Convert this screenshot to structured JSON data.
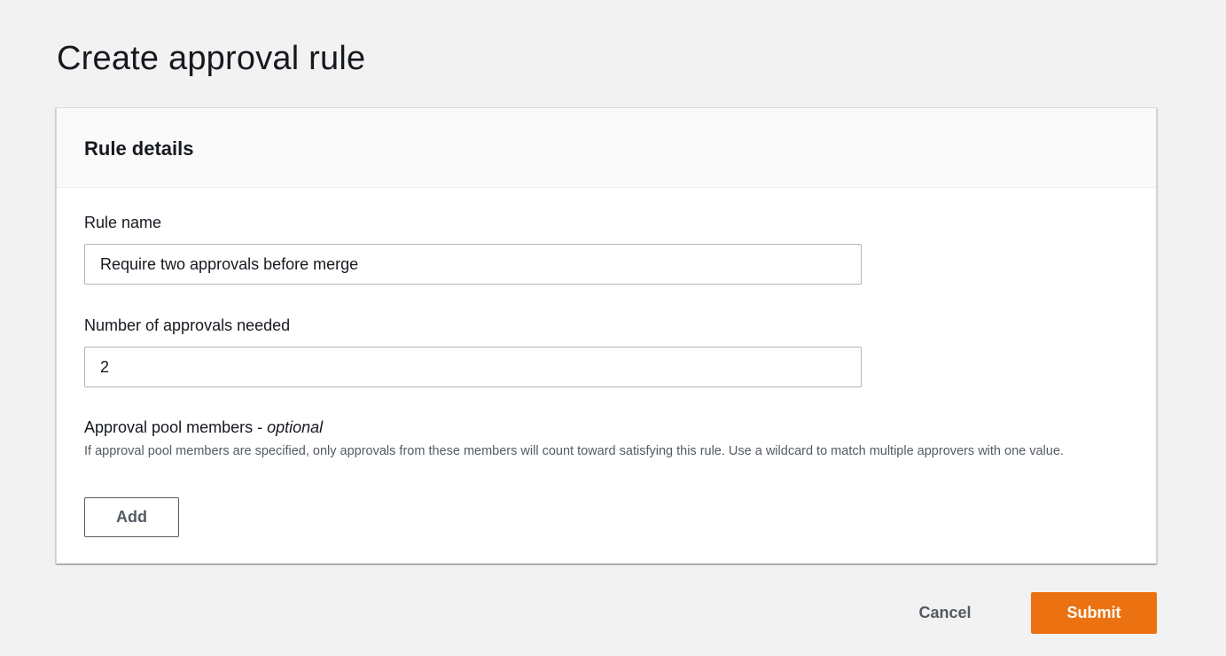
{
  "page": {
    "title": "Create approval rule"
  },
  "rule_details": {
    "heading": "Rule details",
    "rule_name": {
      "label": "Rule name",
      "value": "Require two approvals before merge"
    },
    "approvals_needed": {
      "label": "Number of approvals needed",
      "value": "2"
    },
    "approval_pool": {
      "label": "Approval pool members - ",
      "label_optional": "optional",
      "description": "If approval pool members are specified, only approvals from these members will count toward satisfying this rule. Use a wildcard to match multiple approvers with one value.",
      "add_label": "Add"
    }
  },
  "actions": {
    "cancel_label": "Cancel",
    "submit_label": "Submit"
  },
  "colors": {
    "background": "#f2f2f2",
    "primary_button": "#ec7211",
    "secondary_text": "#545b64"
  }
}
